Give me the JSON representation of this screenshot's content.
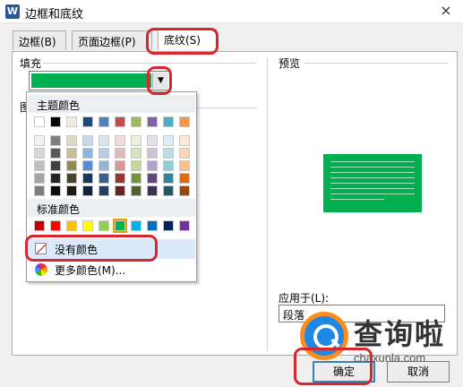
{
  "window": {
    "title": "边框和底纹",
    "app_icon": "W",
    "close": "×"
  },
  "tabs": [
    {
      "label": "边框(B)",
      "active": false
    },
    {
      "label": "页面边框(P)",
      "active": false
    },
    {
      "label": "底纹(S)",
      "active": true
    }
  ],
  "fill": {
    "label": "填充",
    "current_color": "#00B050",
    "dropdown_arrow": "▼"
  },
  "pattern": {
    "label": "图"
  },
  "preview": {
    "label": "预览",
    "color": "#00B050"
  },
  "color_popup": {
    "theme_header": "主题颜色",
    "theme_top_row": [
      "#FFFFFF",
      "#000000",
      "#EEECE1",
      "#1F497D",
      "#4F81BD",
      "#C0504D",
      "#9BBB59",
      "#8064A2",
      "#4BACC6",
      "#F79646"
    ],
    "theme_shades": [
      [
        "#F2F2F2",
        "#7F7F7F",
        "#DDD9C3",
        "#C6D9F0",
        "#DBE5F1",
        "#F2DCDB",
        "#EBF1DD",
        "#E5E0EC",
        "#DBEEF3",
        "#FDEADA"
      ],
      [
        "#D8D8D8",
        "#595959",
        "#C4BD97",
        "#8DB3E2",
        "#B8CCE4",
        "#E5B9B7",
        "#D7E3BC",
        "#CCC1D9",
        "#B7DDE8",
        "#FBD5B5"
      ],
      [
        "#BFBFBF",
        "#3F3F3F",
        "#938953",
        "#548DD4",
        "#95B3D7",
        "#D99694",
        "#C3D69B",
        "#B2A2C7",
        "#92CDDC",
        "#FAC08F"
      ],
      [
        "#A5A5A5",
        "#262626",
        "#494429",
        "#17365D",
        "#366092",
        "#953734",
        "#76923C",
        "#5F497A",
        "#31859B",
        "#E36C09"
      ],
      [
        "#7F7F7F",
        "#0C0C0C",
        "#1D1B10",
        "#0F243E",
        "#244061",
        "#632423",
        "#4F6128",
        "#3F3151",
        "#205867",
        "#974806"
      ]
    ],
    "standard_header": "标准颜色",
    "standard_colors": [
      "#C00000",
      "#FF0000",
      "#FFC000",
      "#FFFF00",
      "#92D050",
      "#00B050",
      "#00B0F0",
      "#0070C0",
      "#002060",
      "#7030A0"
    ],
    "selected_standard_index": 5,
    "no_color_label": "没有颜色",
    "more_colors_label": "更多颜色(M)..."
  },
  "apply_to": {
    "label": "应用于(L):",
    "value": "段落"
  },
  "buttons": {
    "ok": "确定",
    "cancel": "取消"
  },
  "watermark": {
    "brand": "查询啦",
    "url": "chaxunla.com"
  }
}
